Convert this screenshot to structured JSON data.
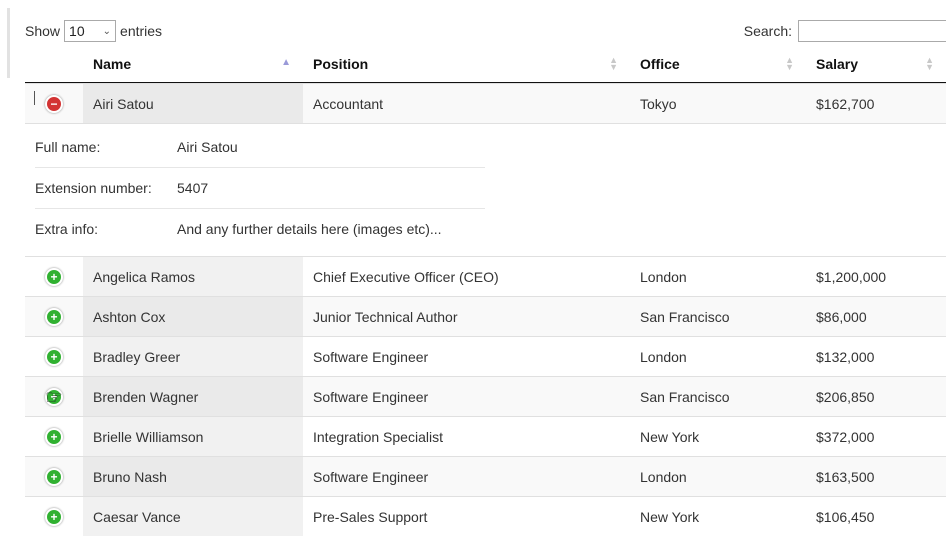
{
  "length": {
    "show": "Show",
    "value": "10",
    "entries": "entries"
  },
  "search": {
    "label": "Search:",
    "value": ""
  },
  "columns": {
    "name": "Name",
    "position": "Position",
    "office": "Office",
    "salary": "Salary"
  },
  "rows": [
    {
      "name": "Airi Satou",
      "position": "Accountant",
      "office": "Tokyo",
      "salary": "$162,700",
      "expanded": true
    },
    {
      "name": "Angelica Ramos",
      "position": "Chief Executive Officer (CEO)",
      "office": "London",
      "salary": "$1,200,000"
    },
    {
      "name": "Ashton Cox",
      "position": "Junior Technical Author",
      "office": "San Francisco",
      "salary": "$86,000"
    },
    {
      "name": "Bradley Greer",
      "position": "Software Engineer",
      "office": "London",
      "salary": "$132,000"
    },
    {
      "name": "Brenden Wagner",
      "position": "Software Engineer",
      "office": "San Francisco",
      "salary": "$206,850"
    },
    {
      "name": "Brielle Williamson",
      "position": "Integration Specialist",
      "office": "New York",
      "salary": "$372,000"
    },
    {
      "name": "Bruno Nash",
      "position": "Software Engineer",
      "office": "London",
      "salary": "$163,500"
    },
    {
      "name": "Caesar Vance",
      "position": "Pre-Sales Support",
      "office": "New York",
      "salary": "$106,450"
    }
  ],
  "detail": [
    {
      "label": "Full name:",
      "value": "Airi Satou"
    },
    {
      "label": "Extension number:",
      "value": "5407"
    },
    {
      "label": "Extra info:",
      "value": "And any further details here (images etc)..."
    }
  ],
  "icons": {
    "expand": "plus-icon",
    "collapse": "minus-icon",
    "sort_asc": "sort-asc-icon",
    "sort_both": "sort-both-icon"
  },
  "colors": {
    "collapse": "#d33333",
    "expand": "#31b131"
  }
}
